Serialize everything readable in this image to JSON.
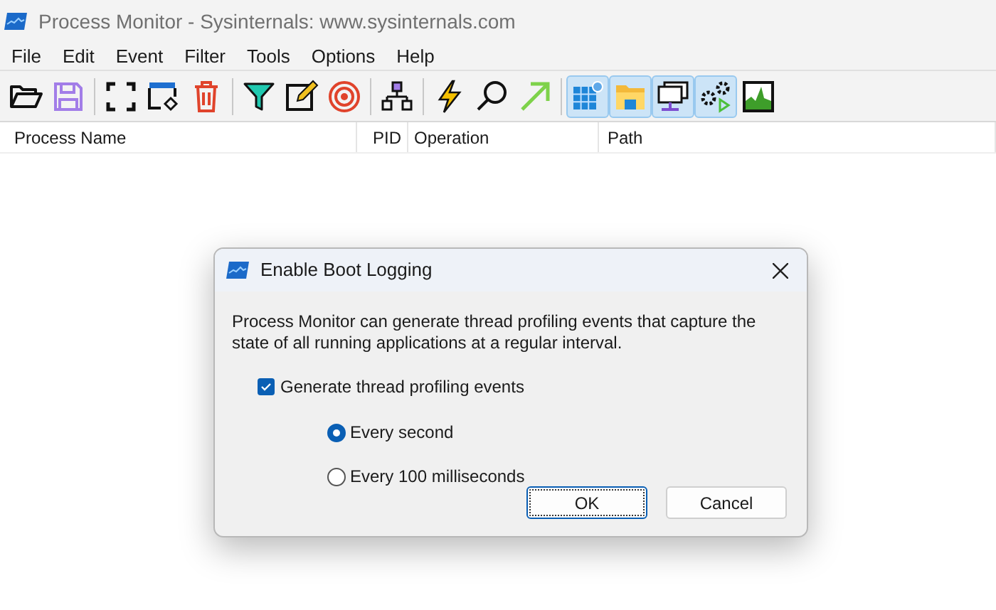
{
  "window": {
    "title": "Process Monitor - Sysinternals: www.sysinternals.com"
  },
  "menu": [
    "File",
    "Edit",
    "Event",
    "Filter",
    "Tools",
    "Options",
    "Help"
  ],
  "toolbar": [
    [
      {
        "kind": "open"
      },
      {
        "kind": "save"
      }
    ],
    [
      {
        "kind": "autoscroll"
      },
      {
        "kind": "autoscroll2"
      },
      {
        "kind": "clear"
      }
    ],
    [
      {
        "kind": "filter"
      },
      {
        "kind": "highlight"
      },
      {
        "kind": "target"
      }
    ],
    [
      {
        "kind": "tree"
      }
    ],
    [
      {
        "kind": "bolt"
      },
      {
        "kind": "find"
      },
      {
        "kind": "jump"
      }
    ],
    [
      {
        "kind": "registry",
        "selected": true
      },
      {
        "kind": "files",
        "selected": true
      },
      {
        "kind": "network",
        "selected": true
      },
      {
        "kind": "process",
        "selected": true
      },
      {
        "kind": "profiling",
        "selected": false
      }
    ]
  ],
  "table": {
    "columns": [
      "Process Name",
      "PID",
      "Operation",
      "Path"
    ]
  },
  "dialog": {
    "title": "Enable Boot Logging",
    "message": "Process Monitor can generate thread profiling events that capture the state of all running applications at a regular interval.",
    "checkbox": {
      "label": "Generate thread profiling events",
      "checked": true
    },
    "options": [
      {
        "label": "Every second",
        "selected": true
      },
      {
        "label": "Every 100 milliseconds",
        "selected": false
      }
    ],
    "buttons": [
      {
        "label": "OK",
        "default": true
      },
      {
        "label": "Cancel",
        "default": false
      }
    ]
  }
}
